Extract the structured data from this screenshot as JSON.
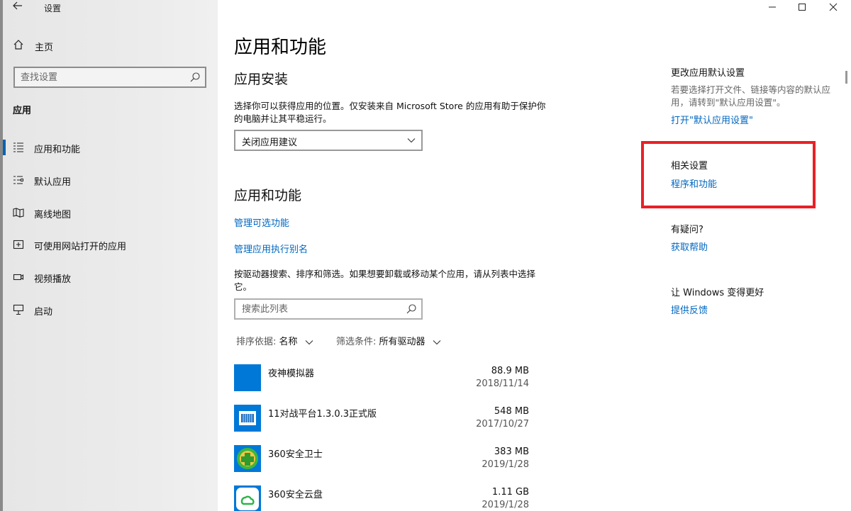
{
  "window": {
    "title": "设置",
    "controls": [
      "minimize",
      "maximize",
      "close"
    ]
  },
  "sidebar": {
    "home_label": "主页",
    "search_placeholder": "查找设置",
    "section_label": "应用",
    "items": [
      {
        "label": "应用和功能",
        "icon": "apps-features-icon",
        "active": true
      },
      {
        "label": "默认应用",
        "icon": "default-apps-icon",
        "active": false
      },
      {
        "label": "离线地图",
        "icon": "offline-maps-icon",
        "active": false
      },
      {
        "label": "可使用网站打开的应用",
        "icon": "apps-for-websites-icon",
        "active": false
      },
      {
        "label": "视频播放",
        "icon": "video-playback-icon",
        "active": false
      },
      {
        "label": "启动",
        "icon": "startup-icon",
        "active": false
      }
    ]
  },
  "main": {
    "page_title": "应用和功能",
    "install": {
      "heading": "应用安装",
      "description": "选择你可以获得应用的位置。仅安装来自 Microsoft Store 的应用有助于保护你的电脑并让其平稳运行。",
      "dropdown_value": "关闭应用建议"
    },
    "apps": {
      "heading": "应用和功能",
      "link_optional": "管理可选功能",
      "link_alias": "管理应用执行别名",
      "description": "按驱动器搜索、排序和筛选。如果想要卸载或移动某个应用，请从列表中选择它。",
      "search_placeholder": "搜索此列表",
      "sort_key": "排序依据:",
      "sort_value": "名称",
      "filter_key": "筛选条件:",
      "filter_value": "所有驱动器",
      "list": [
        {
          "name": "夜神模拟器",
          "size": "88.9 MB",
          "date": "2018/11/14",
          "icon": "nox-emulator-icon"
        },
        {
          "name": "11对战平台1.3.0.3正式版",
          "size": "548 MB",
          "date": "2017/10/27",
          "icon": "11-platform-icon"
        },
        {
          "name": "360安全卫士",
          "size": "383 MB",
          "date": "2019/1/28",
          "icon": "360-security-icon"
        },
        {
          "name": "360安全云盘",
          "size": "1.11 GB",
          "date": "2019/1/28",
          "icon": "360-cloud-icon"
        }
      ]
    }
  },
  "right": {
    "default_heading": "更改应用默认设置",
    "default_desc": "若要选择打开文件、链接等内容的默认应用，请转到\"默认应用设置\"。",
    "default_link": "打开\"默认应用设置\"",
    "related_heading": "相关设置",
    "related_link": "程序和功能",
    "question_heading": "有疑问?",
    "question_link": "获取帮助",
    "improve_heading": "让 Windows 变得更好",
    "improve_link": "提供反馈"
  },
  "colors": {
    "accent": "#0067c0",
    "highlight": "#ea2026",
    "active_indicator": "#0063b1"
  }
}
